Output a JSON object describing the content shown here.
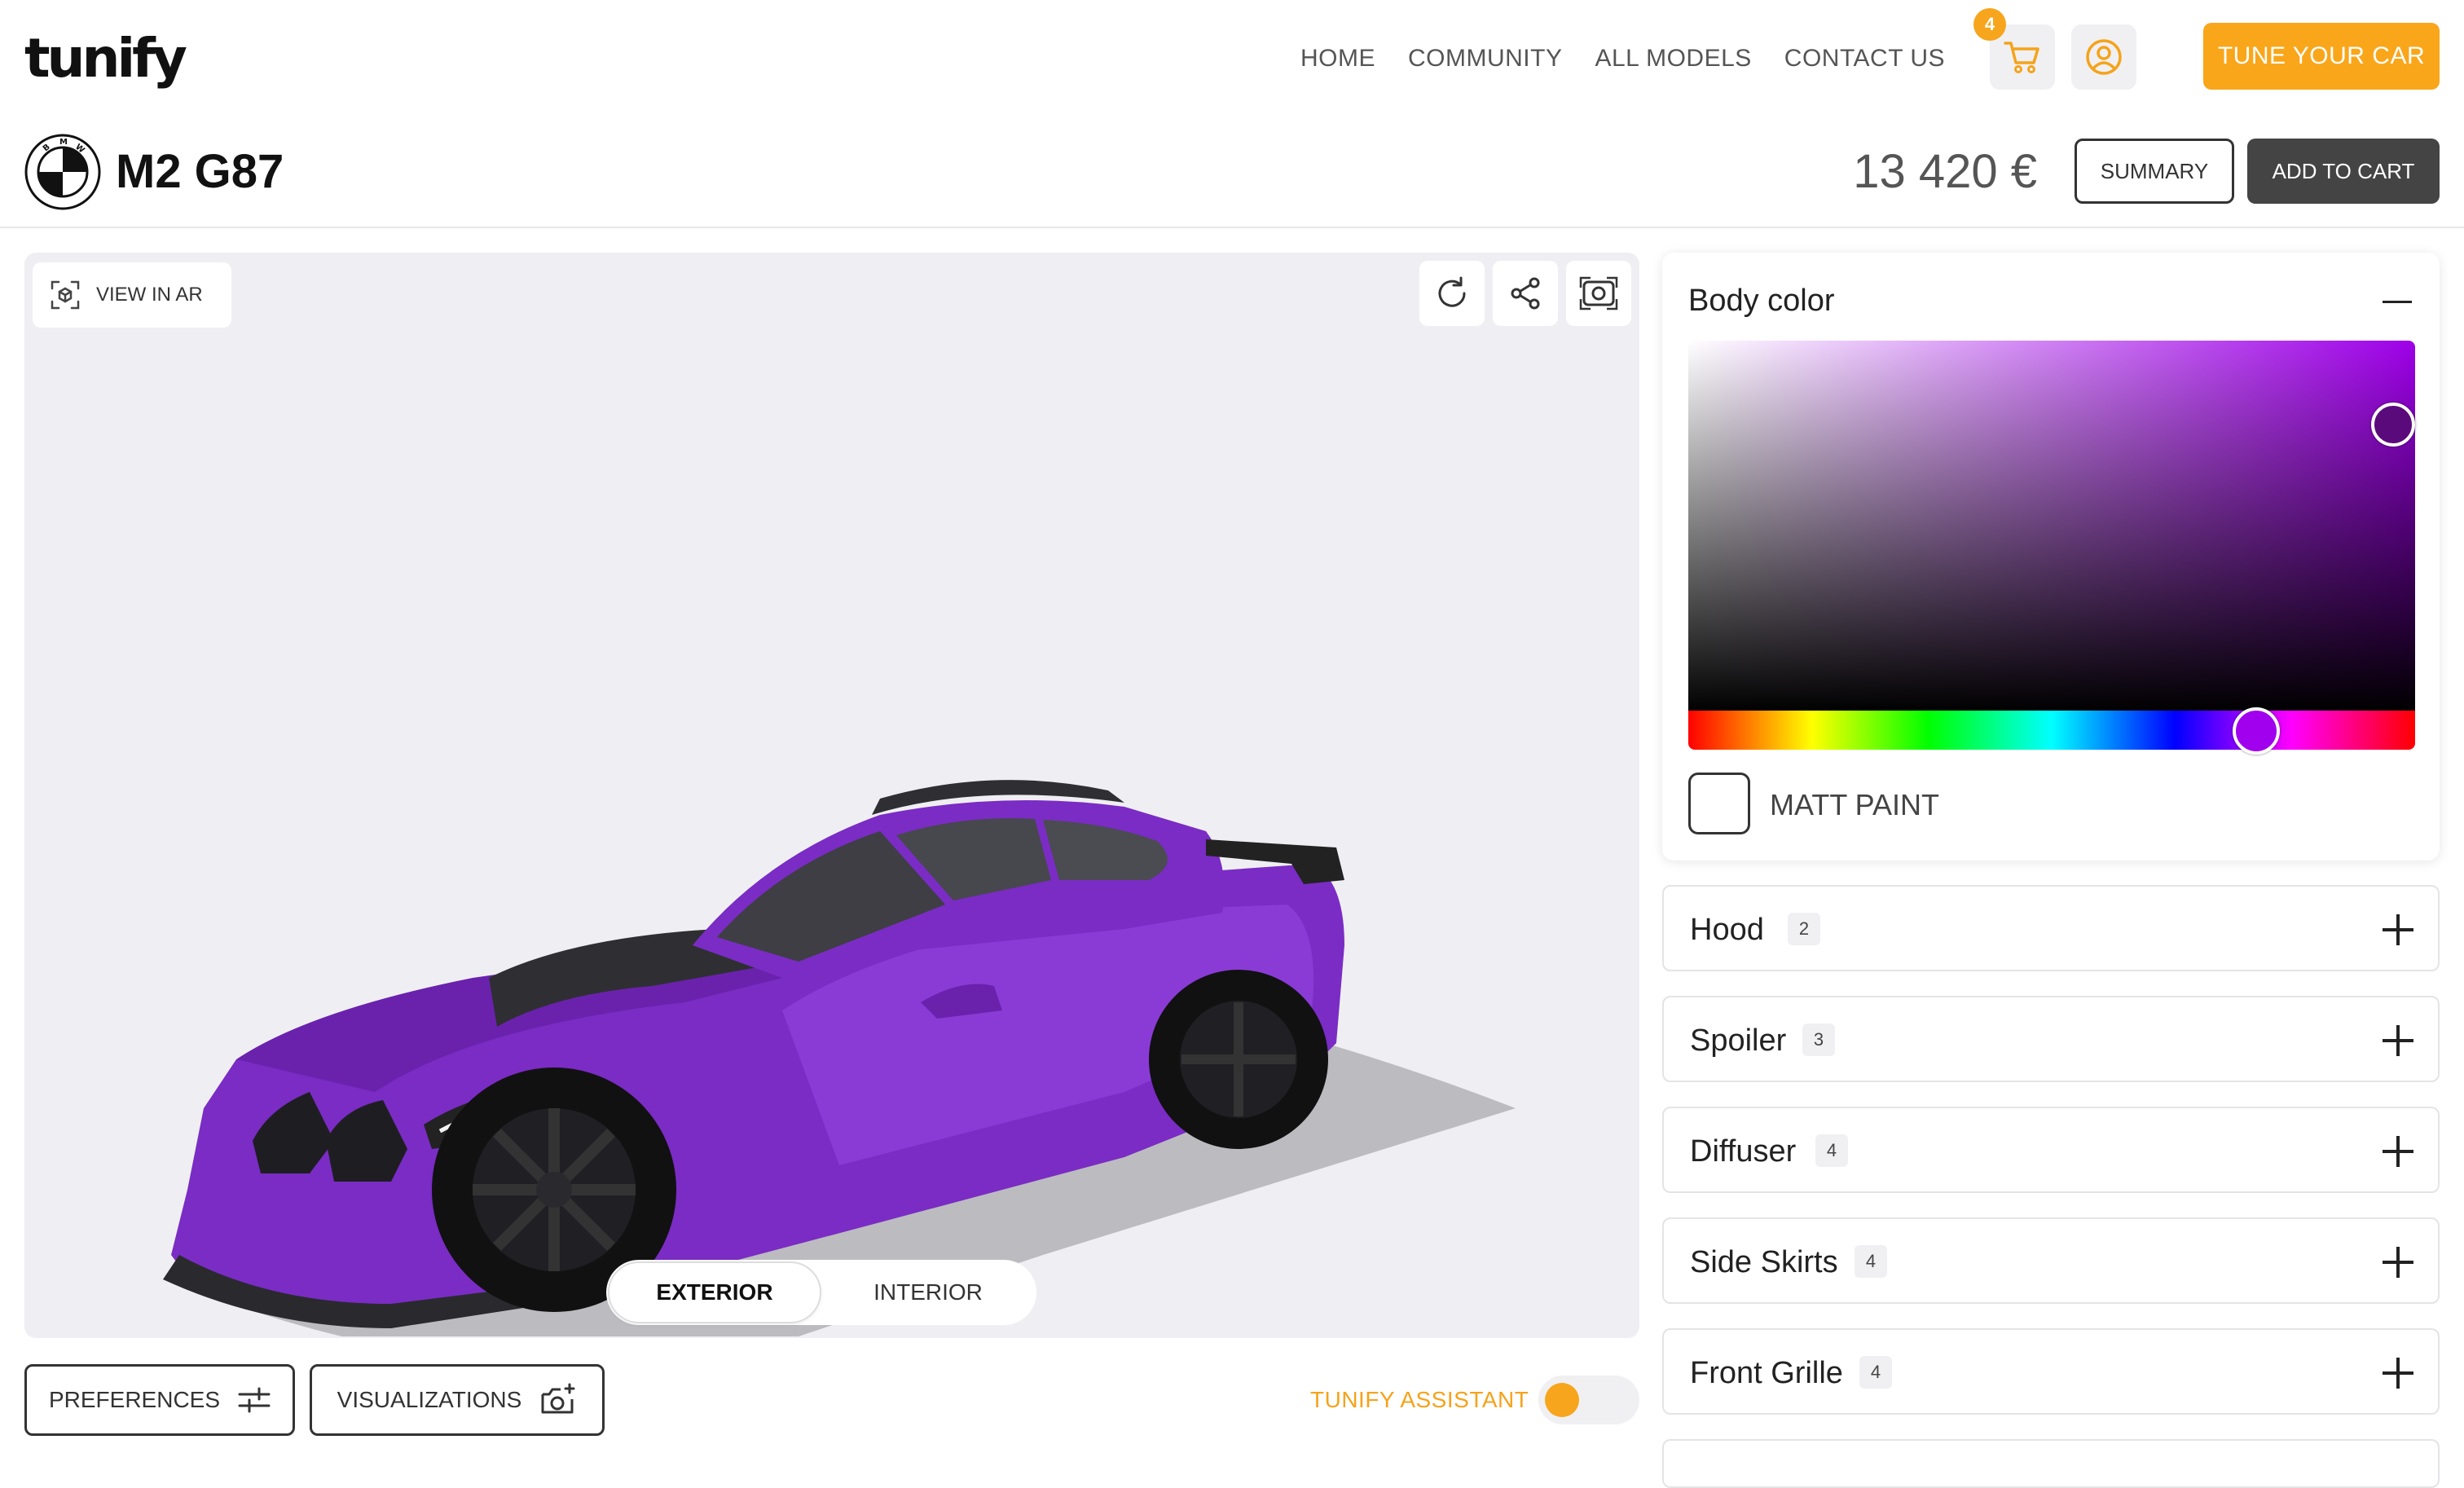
{
  "brand": {
    "logo_text": "tunify"
  },
  "nav": {
    "items": [
      "HOME",
      "COMMUNITY",
      "ALL MODELS",
      "CONTACT US"
    ]
  },
  "header": {
    "cart_count": "4",
    "cta_label": "TUNE YOUR CAR",
    "accent_color": "#f9a61a"
  },
  "product": {
    "manufacturer_logo_text": "BMW",
    "model": "M2 G87",
    "price": "13 420 €",
    "summary_label": "SUMMARY",
    "add_to_cart_label": "ADD TO CART"
  },
  "viewer": {
    "ar_label": "VIEW IN AR",
    "tools": [
      "refresh-icon",
      "share-icon",
      "screenshot-icon"
    ],
    "tabs": [
      "EXTERIOR",
      "INTERIOR"
    ],
    "active_tab": "EXTERIOR",
    "car_color": "#7a2cc4"
  },
  "bottom": {
    "preferences_label": "PREFERENCES",
    "visualizations_label": "VISUALIZATIONS",
    "assistant_label": "TUNIFY ASSISTANT"
  },
  "config": {
    "body_color": {
      "title": "Body color",
      "selected_hue_color": "#a000ee",
      "selected_color": "#5a0a7a",
      "matt_paint_label": "MATT PAINT",
      "matt_paint_checked": false
    },
    "sections": [
      {
        "label": "Hood",
        "count": "2"
      },
      {
        "label": "Spoiler",
        "count": "3"
      },
      {
        "label": "Diffuser",
        "count": "4"
      },
      {
        "label": "Side Skirts",
        "count": "4"
      },
      {
        "label": "Front Grille",
        "count": "4"
      }
    ]
  }
}
